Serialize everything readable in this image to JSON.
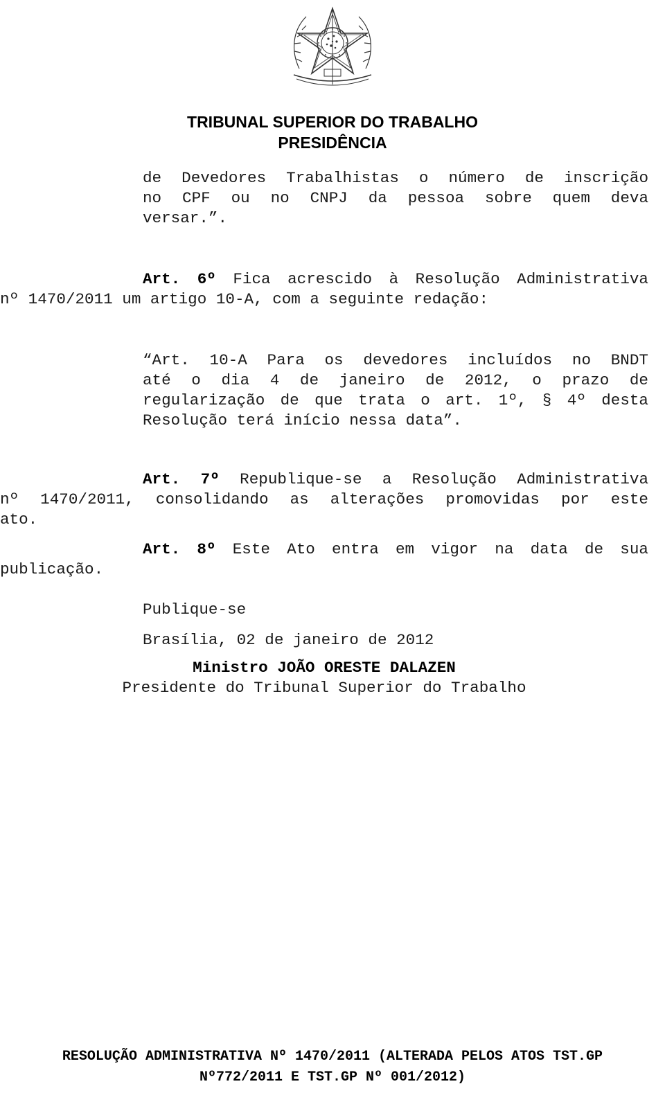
{
  "header": {
    "emblem": "brazil-coat-of-arms-icon",
    "line1": "TRIBUNAL SUPERIOR DO TRABALHO",
    "line2": "PRESIDÊNCIA"
  },
  "body": {
    "continuation": {
      "lines": [
        "de Devedores Trabalhistas o número de inscrição",
        "no CPF ou no CNPJ da pessoa sobre quem deva",
        "versar.”."
      ]
    },
    "art6": {
      "label": "Art.",
      "number": "6º",
      "first_line_rest": "Fica acrescido à Resolução Administrativa",
      "second_line": "nº 1470/2011 um artigo 10-A, com a seguinte redação:"
    },
    "quote_art10a": {
      "lines": [
        "“Art. 10-A Para os devedores incluídos no BNDT",
        "até o dia 4 de janeiro de 2012, o prazo de",
        "regularização de que trata o art. 1º, § 4º desta",
        "Resolução terá início nessa data”."
      ]
    },
    "art7": {
      "label": "Art.",
      "number": "7º",
      "first_line_rest": "Republique-se a Resolução Administrativa",
      "second_line": "nº 1470/2011, consolidando as alterações promovidas por este",
      "third_line": "ato."
    },
    "art8": {
      "label": "Art.",
      "number": "8º",
      "first_line_rest": "Este Ato entra em vigor na data de sua",
      "second_line": "publicação."
    },
    "publique": "Publique-se",
    "place_date": "Brasília, 02 de janeiro de 2012",
    "signer_name": "Ministro JOÃO ORESTE DALAZEN",
    "signer_title": "Presidente do Tribunal Superior do Trabalho"
  },
  "footer": {
    "line1": "RESOLUÇÃO ADMINISTRATIVA Nº 1470/2011 (ALTERADA PELOS ATOS TST.GP",
    "line2": "Nº772/2011 E TST.GP Nº 001/2012)"
  }
}
